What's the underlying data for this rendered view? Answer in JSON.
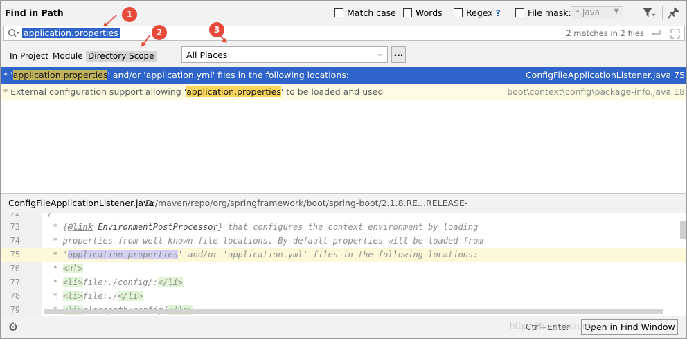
{
  "dialog": {
    "title": "Find in Path",
    "options": {
      "match_case_label": "Match case",
      "words_label": "Words",
      "regex_label": "Regex",
      "regex_help": "?",
      "file_mask_label": "File mask:",
      "file_mask_value": "*.java"
    }
  },
  "search": {
    "query": "application.properties",
    "match_count": "2 matches in 2 files"
  },
  "scope_tabs": [
    "In Project",
    "Module",
    "Directory",
    "Scope"
  ],
  "scope_dropdown": {
    "value": "All Places",
    "more_label": "..."
  },
  "results": [
    {
      "prefix": "* '",
      "match": "application.properties",
      "suffix": "' and/or 'application.yml' files in the following locations:",
      "file": "ConfigFileApplicationListener.java 75"
    },
    {
      "prefix": "* External configuration support allowing '",
      "match": "application.properties",
      "suffix": "' to be loaded and used",
      "file": "boot\\context\\config\\package-info.java 18"
    }
  ],
  "preview": {
    "file_name": "ConfigFileApplicationListener.java",
    "file_path": "D:/maven/repo/org/springframework/boot/spring-boot/2.1.8.RE...RELEASE-sources.jar!/org/springframework/boot/context/config",
    "lines": [
      {
        "num": "72",
        "parts": [
          {
            "t": "/",
            "c": ""
          }
        ]
      },
      {
        "num": "73",
        "parts": [
          {
            "t": " * {",
            "c": ""
          },
          {
            "t": "@link",
            "c": "lnk"
          },
          {
            "t": " EnvironmentPostProcessor",
            "c": "ref"
          },
          {
            "t": "} that configures the context environment by loading",
            "c": ""
          }
        ]
      },
      {
        "num": "74",
        "parts": [
          {
            "t": " * properties from well known file locations. By default properties will be loaded from",
            "c": ""
          }
        ]
      },
      {
        "num": "75",
        "parts": [
          {
            "t": " * '",
            "c": ""
          },
          {
            "t": "application.properties",
            "c": "prop"
          },
          {
            "t": "' and/or 'application.yml' files in the following locations:",
            "c": ""
          }
        ]
      },
      {
        "num": "76",
        "parts": [
          {
            "t": " * ",
            "c": ""
          },
          {
            "t": "<ul>",
            "c": "tag"
          }
        ]
      },
      {
        "num": "77",
        "parts": [
          {
            "t": " * ",
            "c": ""
          },
          {
            "t": "<li>",
            "c": "tag"
          },
          {
            "t": "file:./config/:",
            "c": ""
          },
          {
            "t": "</li>",
            "c": "tag"
          }
        ]
      },
      {
        "num": "78",
        "parts": [
          {
            "t": " * ",
            "c": ""
          },
          {
            "t": "<li>",
            "c": "tag"
          },
          {
            "t": "file:./",
            "c": ""
          },
          {
            "t": "</li>",
            "c": "tag"
          }
        ]
      },
      {
        "num": "79",
        "parts": [
          {
            "t": " * ",
            "c": ""
          },
          {
            "t": "<li>",
            "c": "tag"
          },
          {
            "t": "classpath:config/",
            "c": ""
          },
          {
            "t": "</li>",
            "c": "tag"
          }
        ]
      }
    ],
    "current_line": "75"
  },
  "footer": {
    "shortcut_hint": "Ctrl+Enter",
    "open_button": "Open in Find Window"
  },
  "annotations": [
    "1",
    "2",
    "3"
  ],
  "watermark": "https://blog.csdn.net/..."
}
